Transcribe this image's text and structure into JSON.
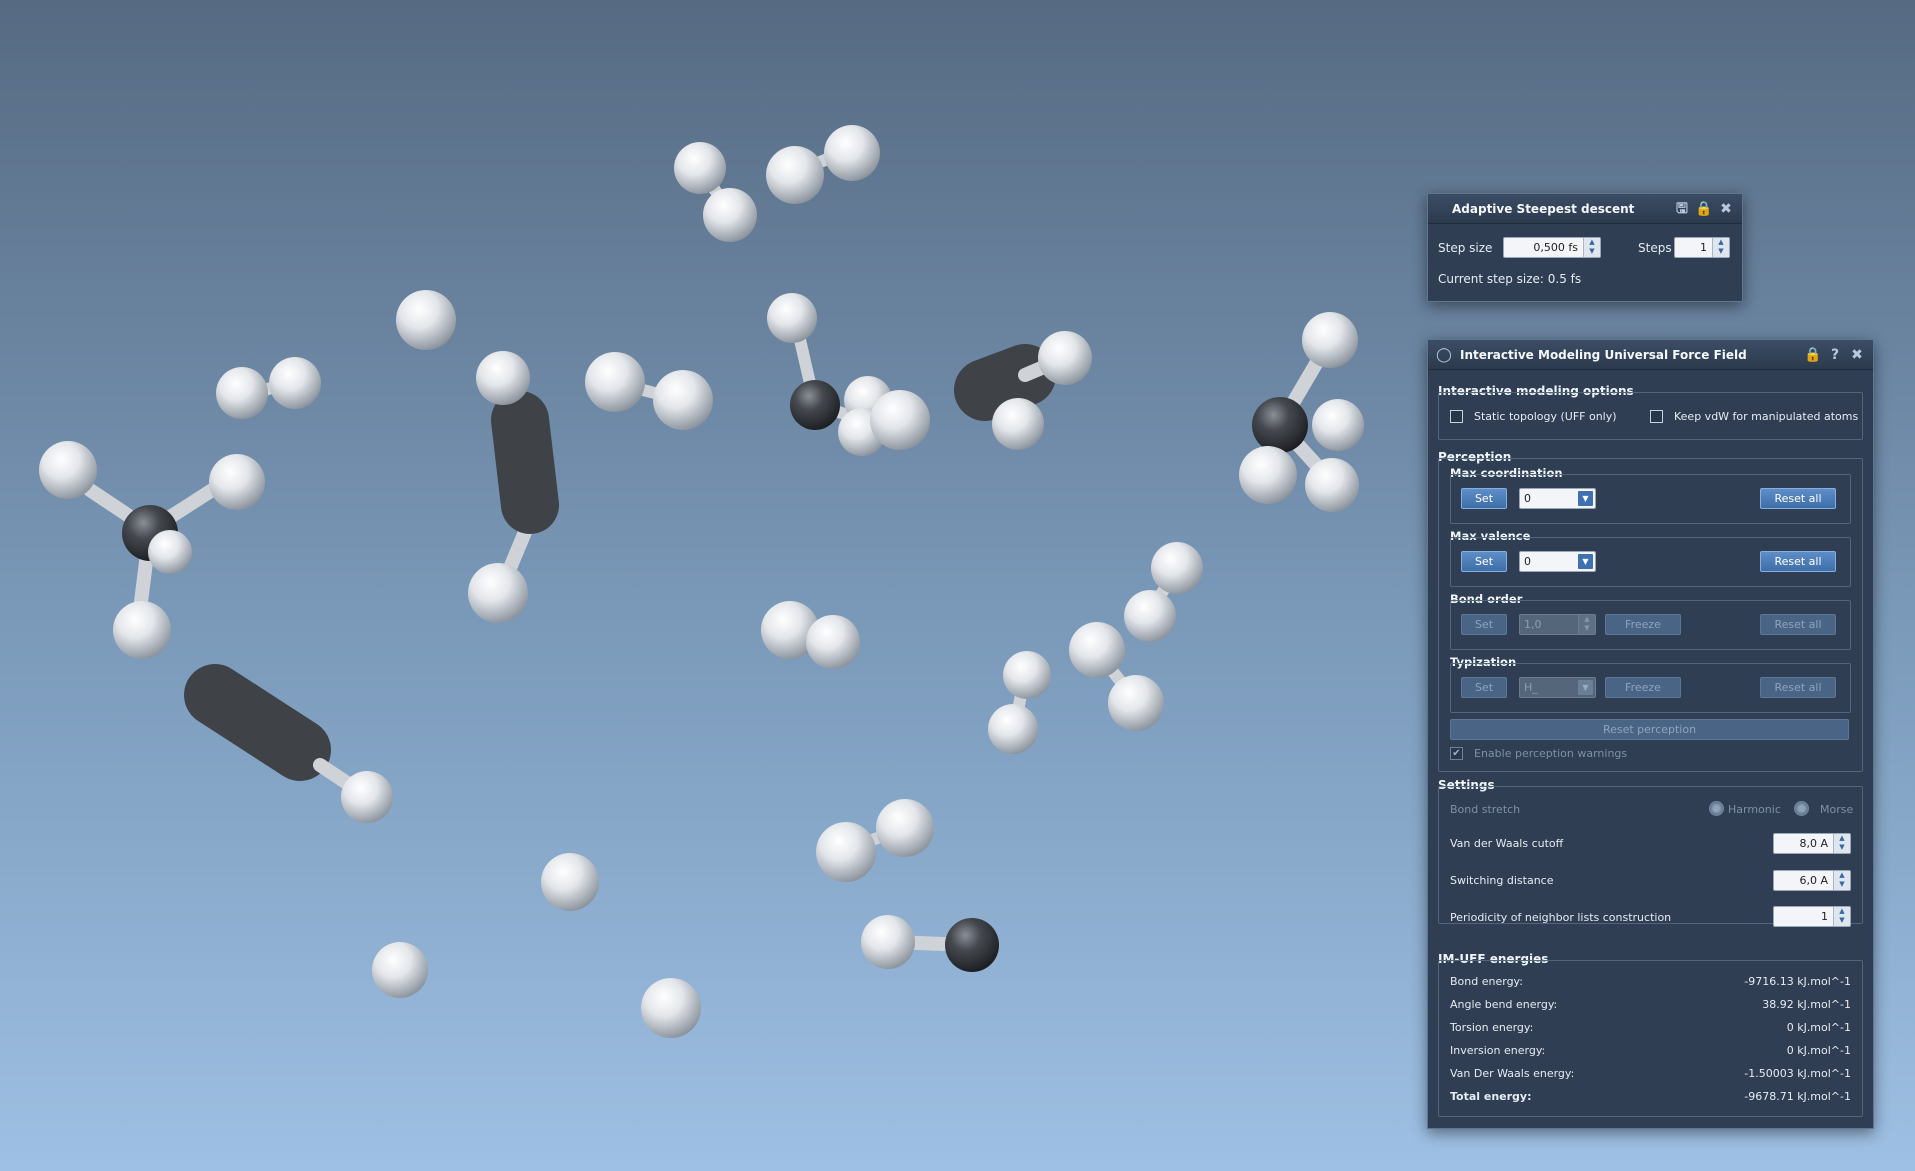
{
  "steepest_panel": {
    "title": "Adaptive Steepest descent",
    "step_size_label": "Step size",
    "step_size_value": "0,500 fs",
    "steps_label": "Steps",
    "steps_value": "1",
    "current_step_text": "Current step size: 0.5 fs"
  },
  "uff_panel": {
    "title": "Interactive Modeling Universal Force Field",
    "options_header": "Interactive modeling options",
    "static_topology_label": "Static topology (UFF only)",
    "keep_vdw_label": "Keep vdW for manipulated atoms",
    "perception_header": "Perception",
    "max_coordination": {
      "label": "Max coordination",
      "set": "Set",
      "value": "0",
      "reset": "Reset all"
    },
    "max_valence": {
      "label": "Max valence",
      "set": "Set",
      "value": "0",
      "reset": "Reset all"
    },
    "bond_order": {
      "label": "Bond order",
      "set": "Set",
      "value": "1,0",
      "freeze": "Freeze",
      "reset": "Reset all"
    },
    "typization": {
      "label": "Typization",
      "set": "Set",
      "value": "H_",
      "freeze": "Freeze",
      "reset": "Reset all"
    },
    "reset_perception": "Reset perception",
    "enable_warnings_label": "Enable perception warnings",
    "settings_header": "Settings",
    "bond_stretch_label": "Bond stretch",
    "harmonic_label": "Harmonic",
    "morse_label": "Morse",
    "vdw_cutoff_label": "Van der Waals cutoff",
    "vdw_cutoff_value": "8,0 A",
    "switching_label": "Switching distance",
    "switching_value": "6,0 A",
    "periodicity_label": "Periodicity of neighbor lists construction",
    "periodicity_value": "1",
    "energies_header": "IM-UFF energies",
    "energies": [
      {
        "label": "Bond energy:",
        "value": "-9716.13 kJ.mol^-1"
      },
      {
        "label": "Angle bend energy:",
        "value": "38.92 kJ.mol^-1"
      },
      {
        "label": "Torsion energy:",
        "value": "0 kJ.mol^-1"
      },
      {
        "label": "Inversion energy:",
        "value": "0 kJ.mol^-1"
      },
      {
        "label": "Van Der Waals energy:",
        "value": "-1.50003 kJ.mol^-1"
      },
      {
        "label": "Total energy:",
        "value": "-9678.71 kJ.mol^-1"
      }
    ]
  },
  "colors": {
    "hydrogen": "#eef0f2",
    "carbon": "#3a3d42",
    "panel": "#2f3e52",
    "accent": "#4a7cbc"
  }
}
